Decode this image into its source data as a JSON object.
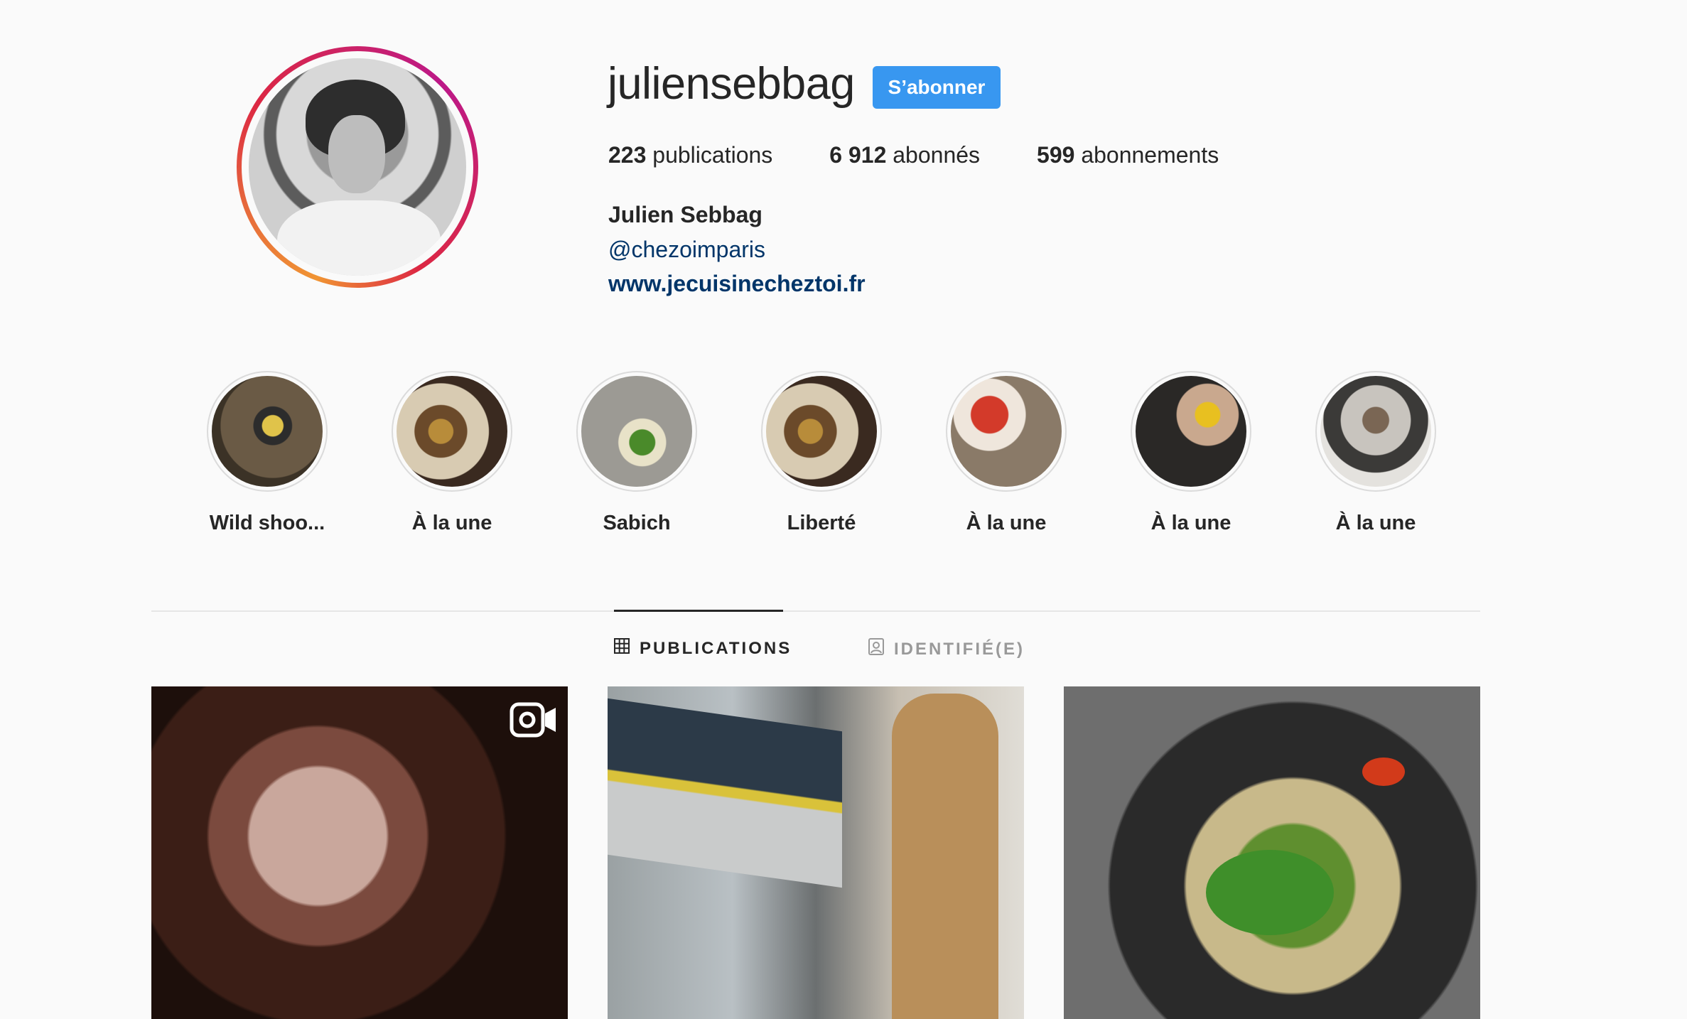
{
  "profile": {
    "username": "juliensebbag",
    "follow_label": "S’abonner",
    "full_name": "Julien Sebbag",
    "mention": "@chezoimparis",
    "website": "www.jecuisinecheztoi.fr",
    "stats": [
      {
        "num": "223",
        "label": "publications"
      },
      {
        "num": "6 912",
        "label": "abonnés"
      },
      {
        "num": "599",
        "label": "abonnements"
      }
    ]
  },
  "highlights": [
    {
      "label": "Wild shoo..."
    },
    {
      "label": "À la une"
    },
    {
      "label": "Sabich"
    },
    {
      "label": "Liberté"
    },
    {
      "label": "À la une"
    },
    {
      "label": "À la une"
    },
    {
      "label": "À la une"
    }
  ],
  "tabs": {
    "publications": "PUBLICATIONS",
    "tagged": "IDENTIFIÉ(E)"
  },
  "colors": {
    "accent": "#3897f0",
    "link": "#003569",
    "background": "#fafafa"
  },
  "icons": [
    "grid-icon",
    "tagged-icon",
    "video-icon"
  ]
}
